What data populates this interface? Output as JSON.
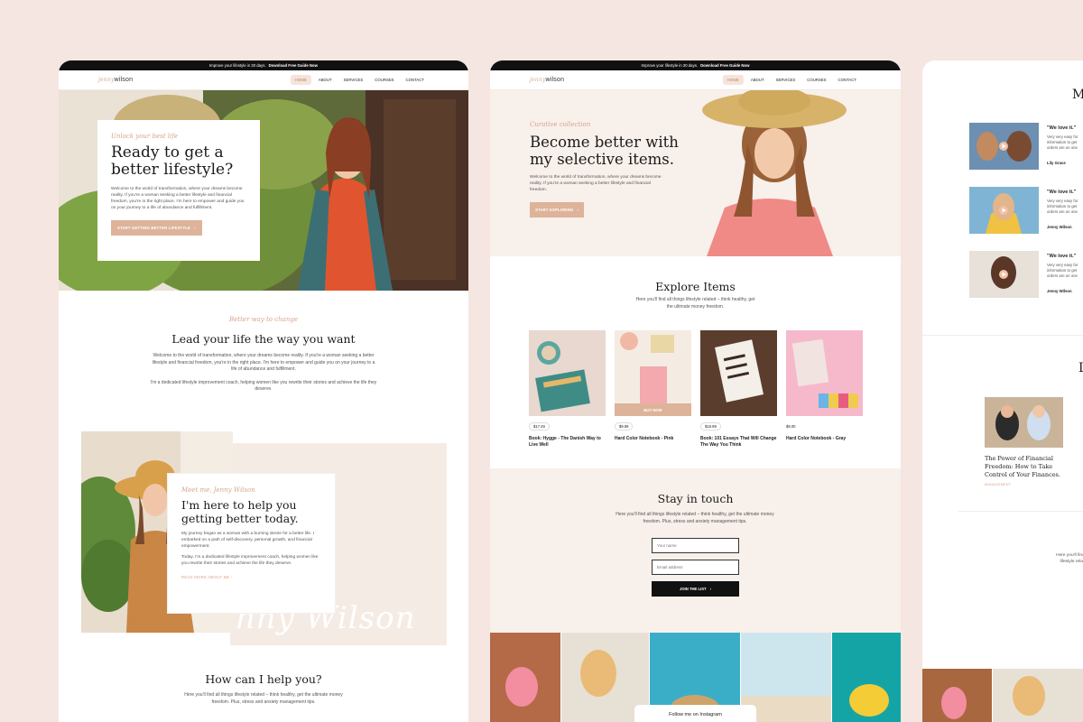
{
  "announcement": {
    "text": "Improve your lifestyle in 30 days.",
    "link": "Download Free Guide Now"
  },
  "brand": {
    "first": "jenny",
    "last": "wilson"
  },
  "nav": [
    "HOME",
    "ABOUT",
    "SERVICES",
    "COURSES",
    "CONTACT"
  ],
  "home": {
    "hero": {
      "eyebrow": "Unlock your best life",
      "title_line1": "Ready to get a",
      "title_line2": "better lifestyle?",
      "body": "Welcome to the world of transformation, where your dreams become reality. If you're a woman seeking a better lifestyle and financial freedom, you're in the right place. I'm here to empower and guide you on your journey to a life of abundance and fulfillment.",
      "cta": "START GETTING BETTER LIFESTYLE"
    },
    "lead": {
      "eyebrow": "Better way to change",
      "title": "Lead your life the way you want",
      "p1": "Welcome to the world of transformation, where your dreams become reality. If you're a woman seeking a better lifestyle and financial freedom, you're in the right place. I'm here to empower and guide you on your journey to a life of abundance and fulfillment.",
      "p2": "I'm a dedicated lifestyle improvement coach, helping women like you rewrite their stories and achieve the life they deserve."
    },
    "meet": {
      "eyebrow": "Meet me, Jenny Wilson",
      "title_line1": "I'm here to help you",
      "title_line2": "getting better today.",
      "p1": "My journey began as a woman with a burning desire for a better life. I embarked on a path of self-discovery, personal growth, and financial empowerment.",
      "p2": "Today, I'm a dedicated lifestyle improvement coach, helping women like you rewrite their stories and achieve the life they deserve.",
      "link": "READ MORE ABOUT ME",
      "watermark": "Jenny Wilson"
    },
    "help": {
      "title": "How can I help you?",
      "body": "Here you'll find all things lifestyle related – think healthy, get the ultimate money freedom. Plus, stress and anxiety management tips."
    }
  },
  "shop": {
    "hero": {
      "eyebrow": "Curative collection",
      "title_line1": "Become better with",
      "title_line2": "my selective items.",
      "body": "Welcome to the world of transformation, where your dreams become reality. If you're a woman seeking a better lifestyle and financial freedom.",
      "cta": "START EXPLORING"
    },
    "explore": {
      "title": "Explore Items",
      "body": "Here you'll find all things lifestyle related – think healthy, get the ultimate money freedom."
    },
    "products": [
      {
        "price": "$17.49",
        "name": "Book: Hygge - The Danish Way to Live Well"
      },
      {
        "price": "$9.99",
        "name": "Hard Color Notebook - Pink",
        "overlay": "BUY NOW"
      },
      {
        "price": "$19.99",
        "name": "Book: 101 Essays That Will Change The Way You Think"
      },
      {
        "price": "$9.00",
        "name": "Hard Color Notebook - Gray"
      }
    ],
    "newsletter": {
      "title": "Stay in touch",
      "body": "Here you'll find all things lifestyle related – think healthy, get the ultimate money freedom. Plus, stress and anxiety management tips.",
      "name_placeholder": "Your name",
      "email_placeholder": "Email address",
      "cta": "JOIN THE LIST"
    },
    "instagram": "Follow me on Instagram"
  },
  "side": {
    "heading_partial": "M",
    "testimonials": [
      {
        "quote": "\"We love it.\"",
        "text": "Very very easy for information to get orders are on one",
        "name": "Lily Grace"
      },
      {
        "quote": "\"We love it.\"",
        "text": "Very very easy for information to get orders are on one",
        "name": "Jenny Wilson"
      },
      {
        "quote": "\"We love it.\"",
        "text": "Very very easy for information to get orders are on one",
        "name": "Jenny Wilson"
      }
    ],
    "heading2_partial": "L",
    "post": {
      "title": "The Power of Financial Freedom: How to Take Control of Your Finances.",
      "tag": "MANAGEMENT"
    },
    "side_text": "Here you'll find all things lifestyle related – think healthy, get the ultimate money freedom."
  },
  "colors": {
    "accent": "#ddb39a",
    "accent_text": "#d6a58b",
    "blush_bg": "#f5e6e1",
    "dark": "#111111"
  }
}
